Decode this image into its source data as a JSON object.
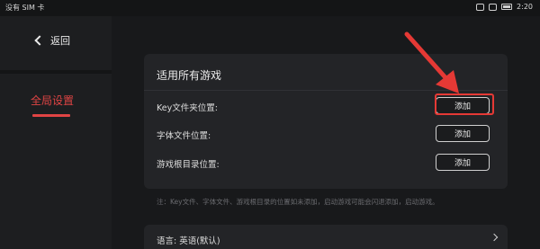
{
  "status_bar": {
    "carrier": "没有 SIM 卡",
    "time": "2:20"
  },
  "sidebar": {
    "back_label": "返回",
    "items": [
      {
        "label": "全局设置",
        "active": true
      }
    ]
  },
  "card": {
    "title": "适用所有游戏",
    "rows": [
      {
        "label": "Key文件夹位置:",
        "button": "添加"
      },
      {
        "label": "字体文件位置:",
        "button": "添加"
      },
      {
        "label": "游戏根目录位置:",
        "button": "添加"
      }
    ]
  },
  "note": "注：Key文件、字体文件、游戏根目录的位置如未添加，启动游戏可能会闪退添加，启动游戏。",
  "language_row": {
    "label": "语言: 英语(默认)"
  },
  "colors": {
    "accent": "#e04444",
    "highlight_box": "#e53935",
    "background": "#18191b",
    "card": "#232427"
  },
  "annotation": {
    "arrow_color": "#e53935",
    "highlighted_button": "card.rows.0.button"
  }
}
